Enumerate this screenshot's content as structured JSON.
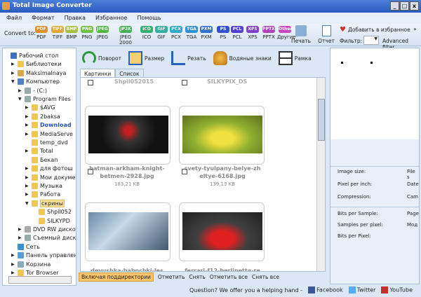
{
  "window": {
    "title": "Total Image Converter",
    "controls": [
      "_",
      "□",
      "x"
    ]
  },
  "menu": [
    "Файл",
    "Формат",
    "Правка",
    "Избранное",
    "Помощь"
  ],
  "toolbar": {
    "convert_label": "Convert to:",
    "formats": [
      {
        "badge": "PDF",
        "label": "PDF",
        "color": "#e0902a"
      },
      {
        "badge": "TIFF",
        "label": "TIFF",
        "color": "#e0a830"
      },
      {
        "badge": "BMP",
        "label": "BMP",
        "color": "#a8c040"
      },
      {
        "badge": "PNG",
        "label": "PNG",
        "color": "#6cc040"
      },
      {
        "badge": "JPEG",
        "label": "JPEG",
        "color": "#50b840"
      },
      {
        "badge": "JP2K",
        "label": "JPEG 2000",
        "color": "#40b050"
      },
      {
        "badge": "ICO",
        "label": "ICO",
        "color": "#30b070"
      },
      {
        "badge": "GIF",
        "label": "GIF",
        "color": "#30b0a0"
      },
      {
        "badge": "PCX",
        "label": "PCX",
        "color": "#30a8c8"
      },
      {
        "badge": "TGA",
        "label": "TGA",
        "color": "#3090d0"
      },
      {
        "badge": "PXM",
        "label": "PXM",
        "color": "#3070d0"
      },
      {
        "badge": "PS",
        "label": "PS",
        "color": "#3050d0"
      },
      {
        "badge": "PCL",
        "label": "PCL",
        "color": "#5040c8"
      },
      {
        "badge": "XPS",
        "label": "XPS",
        "color": "#8040c8"
      },
      {
        "badge": "PPTX",
        "label": "PPTX",
        "color": "#b040c0"
      },
      {
        "badge": "Other",
        "label": "Другие",
        "color": "#d040c0"
      }
    ],
    "print": "Печать",
    "report": "Отчет",
    "add_favorites": "Добавить в избранное",
    "filter_label": "Фильтр:",
    "advanced_filter": "Advanced filter",
    "more": "»"
  },
  "tree": [
    {
      "label": "Рабочий стол",
      "depth": 0,
      "arrow": "",
      "icon": "desktop"
    },
    {
      "label": "Библиотеки",
      "depth": 1,
      "arrow": "▶",
      "icon": "folder"
    },
    {
      "label": "Maksimalnaya",
      "depth": 1,
      "arrow": "▶",
      "icon": "user"
    },
    {
      "label": "Компьютер",
      "depth": 1,
      "arrow": "▼",
      "icon": "computer"
    },
    {
      "label": "- (C:)",
      "depth": 2,
      "arrow": "▶",
      "icon": "drive"
    },
    {
      "label": "Program Files",
      "depth": 2,
      "arrow": "▼",
      "icon": "drive"
    },
    {
      "label": "$AVG",
      "depth": 3,
      "arrow": "▶",
      "icon": "folder"
    },
    {
      "label": "2baksa",
      "depth": 3,
      "arrow": "▶",
      "icon": "folder"
    },
    {
      "label": "Download",
      "depth": 3,
      "arrow": "▶",
      "icon": "folder",
      "highlight": true
    },
    {
      "label": "MediaServe",
      "depth": 3,
      "arrow": "▶",
      "icon": "folder"
    },
    {
      "label": "temp_dvd",
      "depth": 3,
      "arrow": "",
      "icon": "folder"
    },
    {
      "label": "Total",
      "depth": 3,
      "arrow": "▶",
      "icon": "folder"
    },
    {
      "label": "Бекап",
      "depth": 3,
      "arrow": "",
      "icon": "folder"
    },
    {
      "label": "для фотош",
      "depth": 3,
      "arrow": "▶",
      "icon": "folder"
    },
    {
      "label": "Мои докуме",
      "depth": 3,
      "arrow": "▶",
      "icon": "folder"
    },
    {
      "label": "Музыка",
      "depth": 3,
      "arrow": "▶",
      "icon": "folder"
    },
    {
      "label": "Работа",
      "depth": 3,
      "arrow": "▶",
      "icon": "folder"
    },
    {
      "label": "скрины",
      "depth": 3,
      "arrow": "▼",
      "icon": "folder",
      "selected": true
    },
    {
      "label": "Shpil052",
      "depth": 4,
      "arrow": "",
      "icon": "folder"
    },
    {
      "label": "SILKYPD",
      "depth": 4,
      "arrow": "",
      "icon": "folder"
    },
    {
      "label": "DVD RW диско",
      "depth": 2,
      "arrow": "▶",
      "icon": "dvd"
    },
    {
      "label": "Съемный диск",
      "depth": 2,
      "arrow": "▶",
      "icon": "drive"
    },
    {
      "label": "Сеть",
      "depth": 1,
      "arrow": "",
      "icon": "network"
    },
    {
      "label": "Панель управлен",
      "depth": 1,
      "arrow": "▶",
      "icon": "control"
    },
    {
      "label": "Корзина",
      "depth": 1,
      "arrow": "▶",
      "icon": "trash"
    },
    {
      "label": "Tor Browser",
      "depth": 1,
      "arrow": "▶",
      "icon": "folder"
    }
  ],
  "tools": [
    "Поворот",
    "Размер",
    "Резать",
    "Водяные знаки",
    "Рамка"
  ],
  "tabs": [
    "Картинки",
    "Список"
  ],
  "grid": {
    "top_labels": [
      "Shpil052015",
      "SILKYPIX_DS"
    ],
    "items": [
      {
        "name": "batman-arkham-knight-betmen-2928.jpg",
        "line1": "batman-arkham-knight-",
        "line2": "betmen-2928.jpg",
        "size": "183,21 KB"
      },
      {
        "name": "cvety-tyulpany-belye-zheltye-6168.jpg",
        "line1": "cvety-tyulpany-belye-zh",
        "line2": "eltye-6168.jpg",
        "size": "139,13 KB"
      },
      {
        "name": "devushka-babochki-les",
        "line1": "devushka-babochki-les",
        "line2": "",
        "size": ""
      },
      {
        "name": "ferrari-f12-berlinetta-re",
        "line1": "ferrari-f12-berlinetta-re",
        "line2": "",
        "size": ""
      }
    ]
  },
  "bottombar": {
    "subdirs": "Включая поддиректории",
    "check": "Отметить",
    "uncheck": "Снять",
    "check_all": "Отметить все",
    "uncheck_all": "Снять все"
  },
  "info": {
    "left": [
      "Image size:",
      "Pixel per inch:",
      "Compression:",
      "Bits per Sample:",
      "Samples per pixel:",
      "Bits per Pixel:"
    ],
    "right": [
      "File s",
      "Date",
      "Cam",
      "Page",
      "Мод"
    ]
  },
  "status": {
    "question": "Question? We offer you a helping hand -",
    "facebook": "Facebook",
    "twitter": "Twitter",
    "youtube": "YouTube"
  }
}
